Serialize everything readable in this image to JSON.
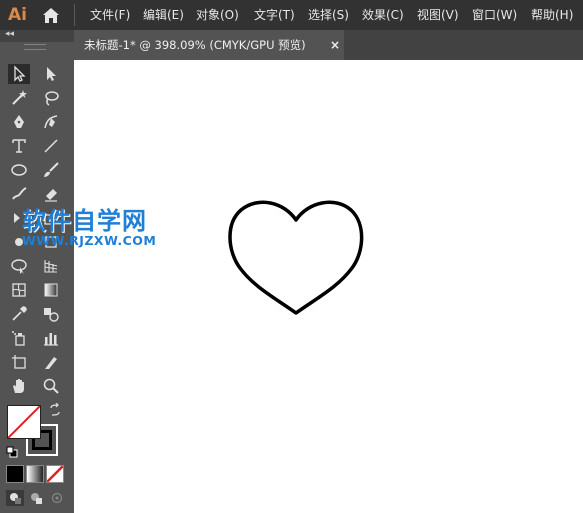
{
  "app": {
    "logo": "Ai"
  },
  "menu": [
    {
      "label": "文件(F)"
    },
    {
      "label": "编辑(E)"
    },
    {
      "label": "对象(O)"
    },
    {
      "label": "文字(T)"
    },
    {
      "label": "选择(S)"
    },
    {
      "label": "效果(C)"
    },
    {
      "label": "视图(V)"
    },
    {
      "label": "窗口(W)"
    },
    {
      "label": "帮助(H)"
    }
  ],
  "document": {
    "tab_title": "未标题-1* @ 398.09% (CMYK/GPU 预览)",
    "close": "×"
  },
  "toolbar": {
    "collapse": "◂◂"
  },
  "watermark": {
    "title": "软件自学网",
    "url": "WWW.RJZXW.COM"
  },
  "colors": {
    "menubar": "#323232",
    "panel": "#535353",
    "tabbar": "#424242",
    "canvas": "#ffffff",
    "watermark": "#1f7fd6",
    "logo": "#d98a4a"
  }
}
